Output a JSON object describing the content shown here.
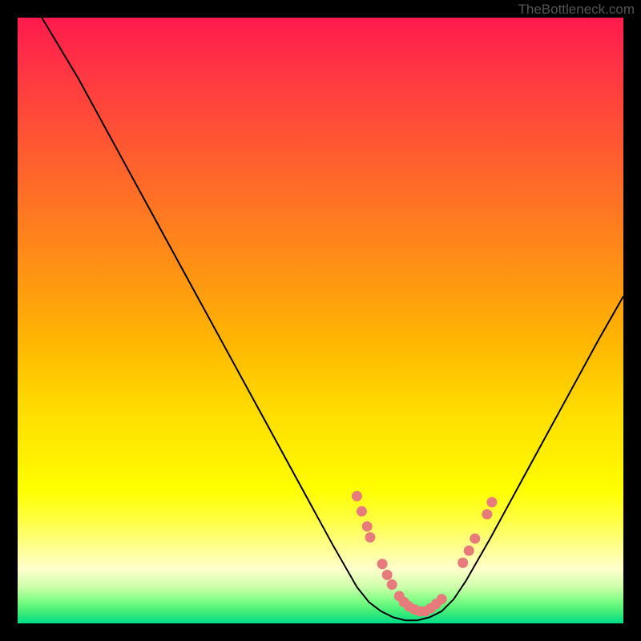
{
  "watermark": "TheBottleneck.com",
  "chart_data": {
    "type": "line",
    "title": "",
    "xlabel": "",
    "ylabel": "",
    "xlim": [
      0,
      100
    ],
    "ylim": [
      0,
      100
    ],
    "series": [
      {
        "name": "bottleneck-curve",
        "stroke": "#000000",
        "x": [
          4,
          10,
          16,
          22,
          28,
          34,
          40,
          46,
          52,
          56,
          58,
          60,
          62,
          64,
          66,
          68,
          70,
          72,
          74,
          78,
          84,
          90,
          96,
          100
        ],
        "y": [
          100,
          90,
          79,
          68,
          57,
          46,
          35,
          24,
          13,
          6,
          3.5,
          2,
          1,
          0.5,
          0.5,
          1,
          2,
          4,
          7,
          14,
          25,
          36,
          47,
          54
        ]
      }
    ],
    "markers": {
      "name": "highlight-dots",
      "color": "#e77a7a",
      "points": [
        {
          "x": 56.0,
          "y": 21.0
        },
        {
          "x": 56.8,
          "y": 18.5
        },
        {
          "x": 57.7,
          "y": 16.0
        },
        {
          "x": 58.2,
          "y": 14.2
        },
        {
          "x": 60.2,
          "y": 9.8
        },
        {
          "x": 61.0,
          "y": 8.0
        },
        {
          "x": 61.8,
          "y": 6.4
        },
        {
          "x": 63.0,
          "y": 4.5
        },
        {
          "x": 63.8,
          "y": 3.5
        },
        {
          "x": 64.6,
          "y": 2.8
        },
        {
          "x": 65.5,
          "y": 2.3
        },
        {
          "x": 66.4,
          "y": 2.0
        },
        {
          "x": 67.3,
          "y": 2.0
        },
        {
          "x": 68.2,
          "y": 2.5
        },
        {
          "x": 69.1,
          "y": 3.2
        },
        {
          "x": 70.0,
          "y": 4.0
        },
        {
          "x": 73.5,
          "y": 10.0
        },
        {
          "x": 74.5,
          "y": 12.0
        },
        {
          "x": 75.5,
          "y": 14.0
        },
        {
          "x": 77.5,
          "y": 18.0
        },
        {
          "x": 78.3,
          "y": 20.0
        }
      ]
    }
  }
}
